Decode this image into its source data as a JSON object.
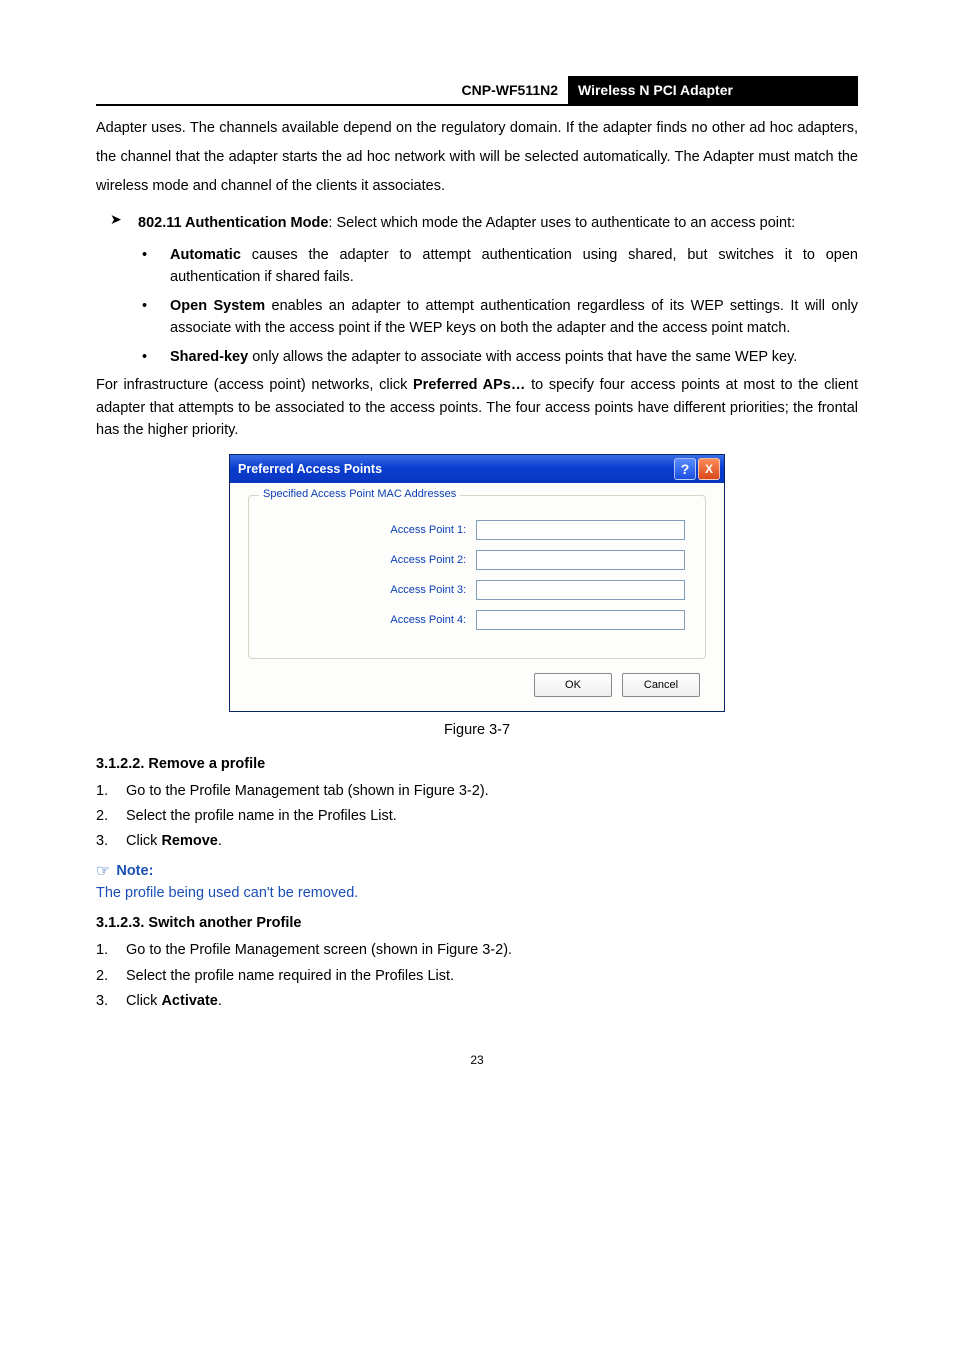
{
  "header": {
    "model": "CNP-WF511N2",
    "product": "Wireless N PCI Adapter"
  },
  "para_top": "Adapter uses. The channels available depend on the regulatory domain. If the adapter finds no other ad hoc adapters, the channel that the adapter starts the ad hoc network with will be selected automatically. The Adapter must match the wireless mode and channel of the clients it associates.",
  "auth": {
    "lead_bold": "802.11 Authentication Mode",
    "lead_rest": ": Select which mode the Adapter uses to authenticate to an access point:",
    "items": [
      {
        "bold": "Automatic",
        "rest": " causes the adapter to attempt authentication using shared, but switches it to open authentication if shared fails."
      },
      {
        "bold": "Open System",
        "rest": " enables an adapter to attempt authentication regardless of its WEP settings. It will only associate with the access point if the WEP keys on both the adapter and the access point match."
      },
      {
        "bold": "Shared-key",
        "rest": " only allows the adapter to associate with access points that have the same WEP key."
      }
    ]
  },
  "infra_para_pre": "For infrastructure (access point) networks, click ",
  "infra_bold": "Preferred APs…",
  "infra_para_post": " to specify four access points at most to the client adapter that attempts to be associated to the access points. The four access points have different priorities; the frontal has the higher priority.",
  "dialog": {
    "title": "Preferred Access Points",
    "help": "?",
    "close": "X",
    "legend": "Specified Access Point MAC Addresses",
    "rows": [
      "Access Point 1:",
      "Access Point 2:",
      "Access Point 3:",
      "Access Point 4:"
    ],
    "ok": "OK",
    "cancel": "Cancel"
  },
  "caption": "Figure 3-7",
  "sec_remove": {
    "head": "3.1.2.2.  Remove a profile",
    "steps": [
      "Go to the Profile Management tab (shown in Figure 3-2).",
      "Select the profile name in the Profiles List."
    ],
    "step3_pre": "Click ",
    "step3_bold": "Remove",
    "step3_post": "."
  },
  "note": {
    "icon": "☞",
    "label": "Note:",
    "text": "The profile being used can't be removed."
  },
  "sec_switch": {
    "head": "3.1.2.3.  Switch another Profile",
    "steps": [
      "Go to the Profile Management screen (shown in Figure 3-2).",
      "Select the profile name required in the Profiles List."
    ],
    "step3_pre": "Click ",
    "step3_bold": "Activate",
    "step3_post": "."
  },
  "pagenum": "23"
}
